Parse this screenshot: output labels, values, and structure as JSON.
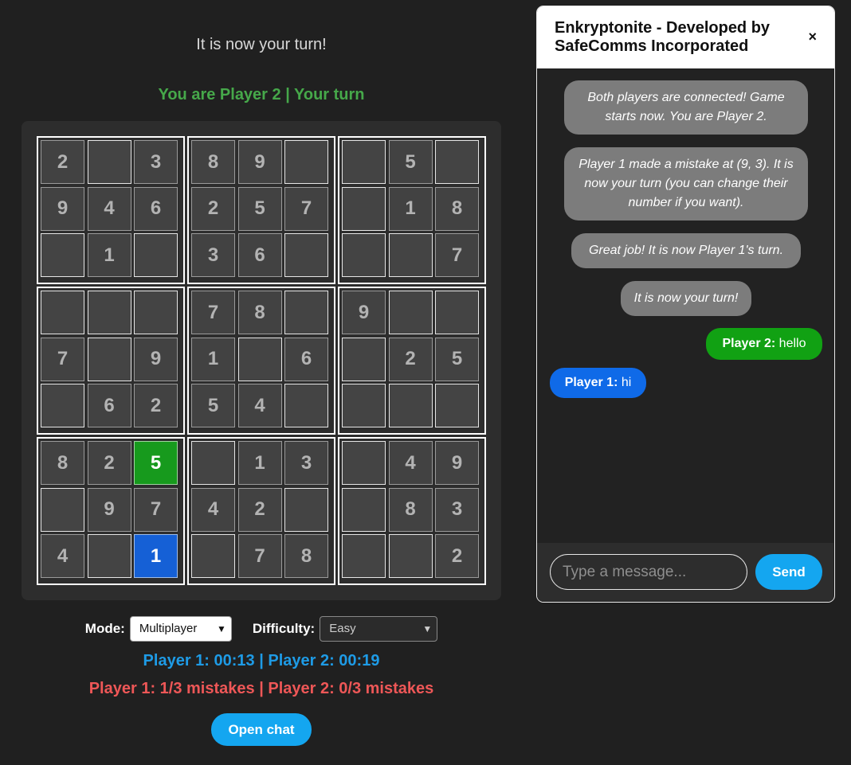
{
  "game": {
    "turn_message": "It is now your turn!",
    "player_status": "You are Player 2 | Your turn",
    "grid": [
      [
        "2",
        "",
        "3",
        "8",
        "9",
        "",
        "",
        "5",
        ""
      ],
      [
        "9",
        "4",
        "6",
        "2",
        "5",
        "7",
        "",
        "1",
        "8"
      ],
      [
        "",
        "1",
        "",
        "3",
        "6",
        "",
        "",
        "",
        "7"
      ],
      [
        "",
        "",
        "",
        "7",
        "8",
        "",
        "9",
        "",
        ""
      ],
      [
        "7",
        "",
        "9",
        "1",
        "",
        "6",
        "",
        "2",
        "5"
      ],
      [
        "",
        "6",
        "2",
        "5",
        "4",
        "",
        "",
        "",
        ""
      ],
      [
        "8",
        "2",
        "5",
        "",
        "1",
        "3",
        "",
        "4",
        "9"
      ],
      [
        "",
        "9",
        "7",
        "4",
        "2",
        "",
        "",
        "8",
        "3"
      ],
      [
        "4",
        "",
        "1",
        "",
        "7",
        "8",
        "",
        "",
        "2"
      ]
    ],
    "highlights": {
      "correct_cell": {
        "row": 6,
        "col": 2
      },
      "selected_cell": {
        "row": 8,
        "col": 2
      }
    },
    "colors": {
      "correct": "#179a1d",
      "selected": "#1560d6"
    }
  },
  "controls": {
    "mode_label": "Mode:",
    "mode_value": "Multiplayer",
    "difficulty_label": "Difficulty:",
    "difficulty_value": "Easy"
  },
  "timers": "Player 1: 00:13 | Player 2: 00:19",
  "mistakes": "Player 1: 1/3 mistakes | Player 2: 0/3 mistakes",
  "open_chat_label": "Open chat",
  "chat": {
    "title": "Enkryptonite - Developed by SafeComms Incorporated",
    "close_icon": "×",
    "messages": [
      {
        "type": "system",
        "text": "Both players are connected! Game starts now. You are Player 2."
      },
      {
        "type": "system",
        "text": "Player 1 made a mistake at (9, 3). It is now your turn (you can change their number if you want)."
      },
      {
        "type": "system",
        "text": "Great job! It is now Player 1's turn."
      },
      {
        "type": "system",
        "text": "It is now your turn!"
      },
      {
        "type": "me",
        "sender": "Player 2:",
        "text": "hello"
      },
      {
        "type": "other",
        "sender": "Player 1:",
        "text": "hi"
      }
    ],
    "input_placeholder": "Type a message...",
    "send_label": "Send"
  }
}
